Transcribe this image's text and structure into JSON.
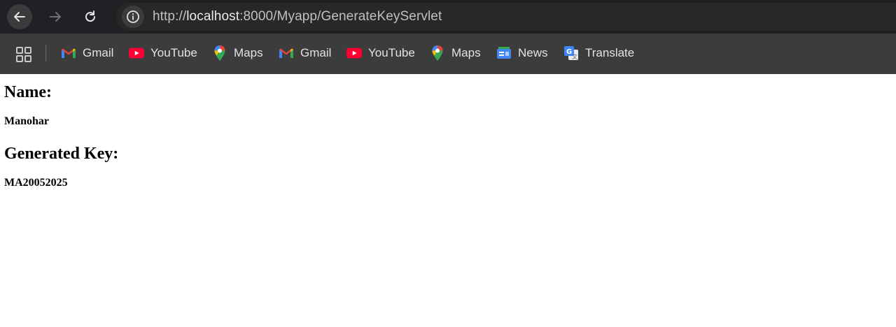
{
  "browser": {
    "url": {
      "scheme": "http://",
      "host": "localhost",
      "rest": ":8000/Myapp/GenerateKeyServlet"
    },
    "colors": {
      "toolbar_bg": "#202124",
      "bookmarks_bg": "#3c3c3c",
      "text": "#e3e3e3"
    }
  },
  "bookmarks": [
    {
      "label": "Gmail",
      "icon": "gmail-icon"
    },
    {
      "label": "YouTube",
      "icon": "youtube-icon"
    },
    {
      "label": "Maps",
      "icon": "maps-icon"
    },
    {
      "label": "Gmail",
      "icon": "gmail-icon"
    },
    {
      "label": "YouTube",
      "icon": "youtube-icon"
    },
    {
      "label": "Maps",
      "icon": "maps-icon"
    },
    {
      "label": "News",
      "icon": "news-icon"
    },
    {
      "label": "Translate",
      "icon": "translate-icon"
    }
  ],
  "page": {
    "name_heading": "Name:",
    "name_value": "Manohar",
    "key_heading": "Generated Key:",
    "key_value": "MA20052025"
  }
}
